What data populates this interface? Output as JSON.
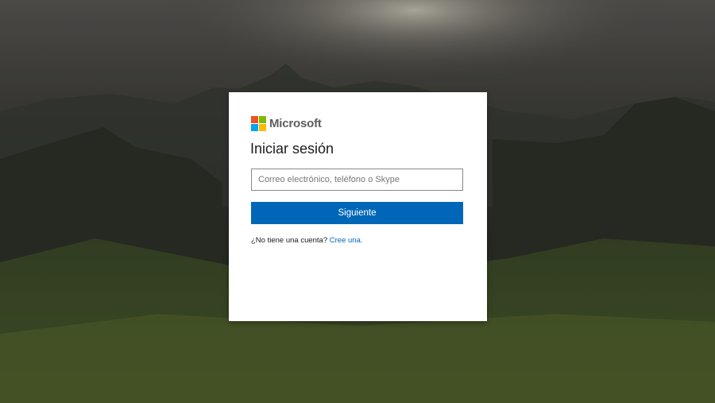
{
  "brand": {
    "name": "Microsoft",
    "logo_colors": [
      "#f25022",
      "#7fba00",
      "#00a4ef",
      "#ffb900"
    ]
  },
  "signin": {
    "title": "Iniciar sesión",
    "email_placeholder": "Correo electrónico, teléfono o Skype",
    "email_value": "",
    "next_label": "Siguiente",
    "no_account_text": "¿No tiene una cuenta?",
    "create_link": "Cree una."
  },
  "colors": {
    "primary_button": "#0067b8",
    "link": "#0067b8"
  }
}
